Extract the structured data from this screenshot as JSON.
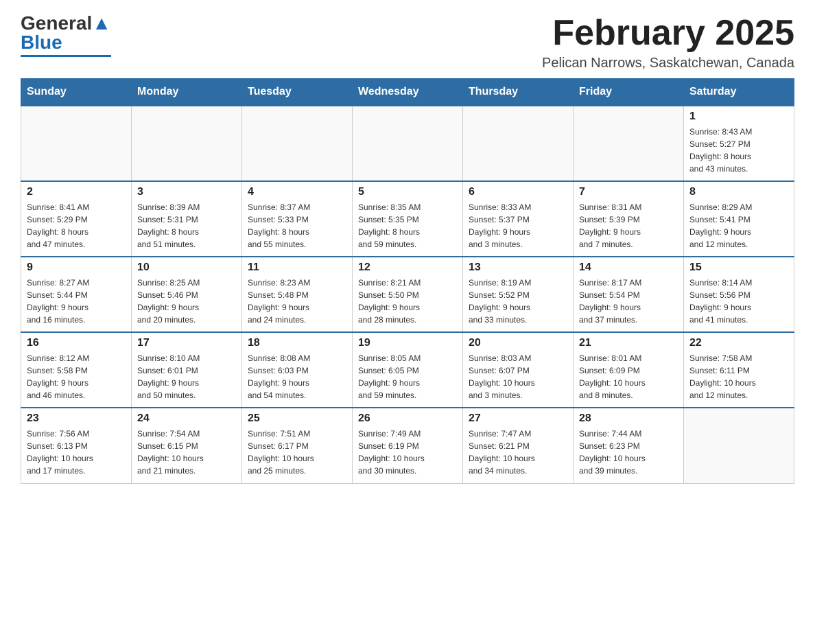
{
  "header": {
    "logo_general": "General",
    "logo_blue": "Blue",
    "month_title": "February 2025",
    "location": "Pelican Narrows, Saskatchewan, Canada"
  },
  "weekdays": [
    "Sunday",
    "Monday",
    "Tuesday",
    "Wednesday",
    "Thursday",
    "Friday",
    "Saturday"
  ],
  "weeks": [
    [
      {
        "day": "",
        "info": ""
      },
      {
        "day": "",
        "info": ""
      },
      {
        "day": "",
        "info": ""
      },
      {
        "day": "",
        "info": ""
      },
      {
        "day": "",
        "info": ""
      },
      {
        "day": "",
        "info": ""
      },
      {
        "day": "1",
        "info": "Sunrise: 8:43 AM\nSunset: 5:27 PM\nDaylight: 8 hours\nand 43 minutes."
      }
    ],
    [
      {
        "day": "2",
        "info": "Sunrise: 8:41 AM\nSunset: 5:29 PM\nDaylight: 8 hours\nand 47 minutes."
      },
      {
        "day": "3",
        "info": "Sunrise: 8:39 AM\nSunset: 5:31 PM\nDaylight: 8 hours\nand 51 minutes."
      },
      {
        "day": "4",
        "info": "Sunrise: 8:37 AM\nSunset: 5:33 PM\nDaylight: 8 hours\nand 55 minutes."
      },
      {
        "day": "5",
        "info": "Sunrise: 8:35 AM\nSunset: 5:35 PM\nDaylight: 8 hours\nand 59 minutes."
      },
      {
        "day": "6",
        "info": "Sunrise: 8:33 AM\nSunset: 5:37 PM\nDaylight: 9 hours\nand 3 minutes."
      },
      {
        "day": "7",
        "info": "Sunrise: 8:31 AM\nSunset: 5:39 PM\nDaylight: 9 hours\nand 7 minutes."
      },
      {
        "day": "8",
        "info": "Sunrise: 8:29 AM\nSunset: 5:41 PM\nDaylight: 9 hours\nand 12 minutes."
      }
    ],
    [
      {
        "day": "9",
        "info": "Sunrise: 8:27 AM\nSunset: 5:44 PM\nDaylight: 9 hours\nand 16 minutes."
      },
      {
        "day": "10",
        "info": "Sunrise: 8:25 AM\nSunset: 5:46 PM\nDaylight: 9 hours\nand 20 minutes."
      },
      {
        "day": "11",
        "info": "Sunrise: 8:23 AM\nSunset: 5:48 PM\nDaylight: 9 hours\nand 24 minutes."
      },
      {
        "day": "12",
        "info": "Sunrise: 8:21 AM\nSunset: 5:50 PM\nDaylight: 9 hours\nand 28 minutes."
      },
      {
        "day": "13",
        "info": "Sunrise: 8:19 AM\nSunset: 5:52 PM\nDaylight: 9 hours\nand 33 minutes."
      },
      {
        "day": "14",
        "info": "Sunrise: 8:17 AM\nSunset: 5:54 PM\nDaylight: 9 hours\nand 37 minutes."
      },
      {
        "day": "15",
        "info": "Sunrise: 8:14 AM\nSunset: 5:56 PM\nDaylight: 9 hours\nand 41 minutes."
      }
    ],
    [
      {
        "day": "16",
        "info": "Sunrise: 8:12 AM\nSunset: 5:58 PM\nDaylight: 9 hours\nand 46 minutes."
      },
      {
        "day": "17",
        "info": "Sunrise: 8:10 AM\nSunset: 6:01 PM\nDaylight: 9 hours\nand 50 minutes."
      },
      {
        "day": "18",
        "info": "Sunrise: 8:08 AM\nSunset: 6:03 PM\nDaylight: 9 hours\nand 54 minutes."
      },
      {
        "day": "19",
        "info": "Sunrise: 8:05 AM\nSunset: 6:05 PM\nDaylight: 9 hours\nand 59 minutes."
      },
      {
        "day": "20",
        "info": "Sunrise: 8:03 AM\nSunset: 6:07 PM\nDaylight: 10 hours\nand 3 minutes."
      },
      {
        "day": "21",
        "info": "Sunrise: 8:01 AM\nSunset: 6:09 PM\nDaylight: 10 hours\nand 8 minutes."
      },
      {
        "day": "22",
        "info": "Sunrise: 7:58 AM\nSunset: 6:11 PM\nDaylight: 10 hours\nand 12 minutes."
      }
    ],
    [
      {
        "day": "23",
        "info": "Sunrise: 7:56 AM\nSunset: 6:13 PM\nDaylight: 10 hours\nand 17 minutes."
      },
      {
        "day": "24",
        "info": "Sunrise: 7:54 AM\nSunset: 6:15 PM\nDaylight: 10 hours\nand 21 minutes."
      },
      {
        "day": "25",
        "info": "Sunrise: 7:51 AM\nSunset: 6:17 PM\nDaylight: 10 hours\nand 25 minutes."
      },
      {
        "day": "26",
        "info": "Sunrise: 7:49 AM\nSunset: 6:19 PM\nDaylight: 10 hours\nand 30 minutes."
      },
      {
        "day": "27",
        "info": "Sunrise: 7:47 AM\nSunset: 6:21 PM\nDaylight: 10 hours\nand 34 minutes."
      },
      {
        "day": "28",
        "info": "Sunrise: 7:44 AM\nSunset: 6:23 PM\nDaylight: 10 hours\nand 39 minutes."
      },
      {
        "day": "",
        "info": ""
      }
    ]
  ]
}
